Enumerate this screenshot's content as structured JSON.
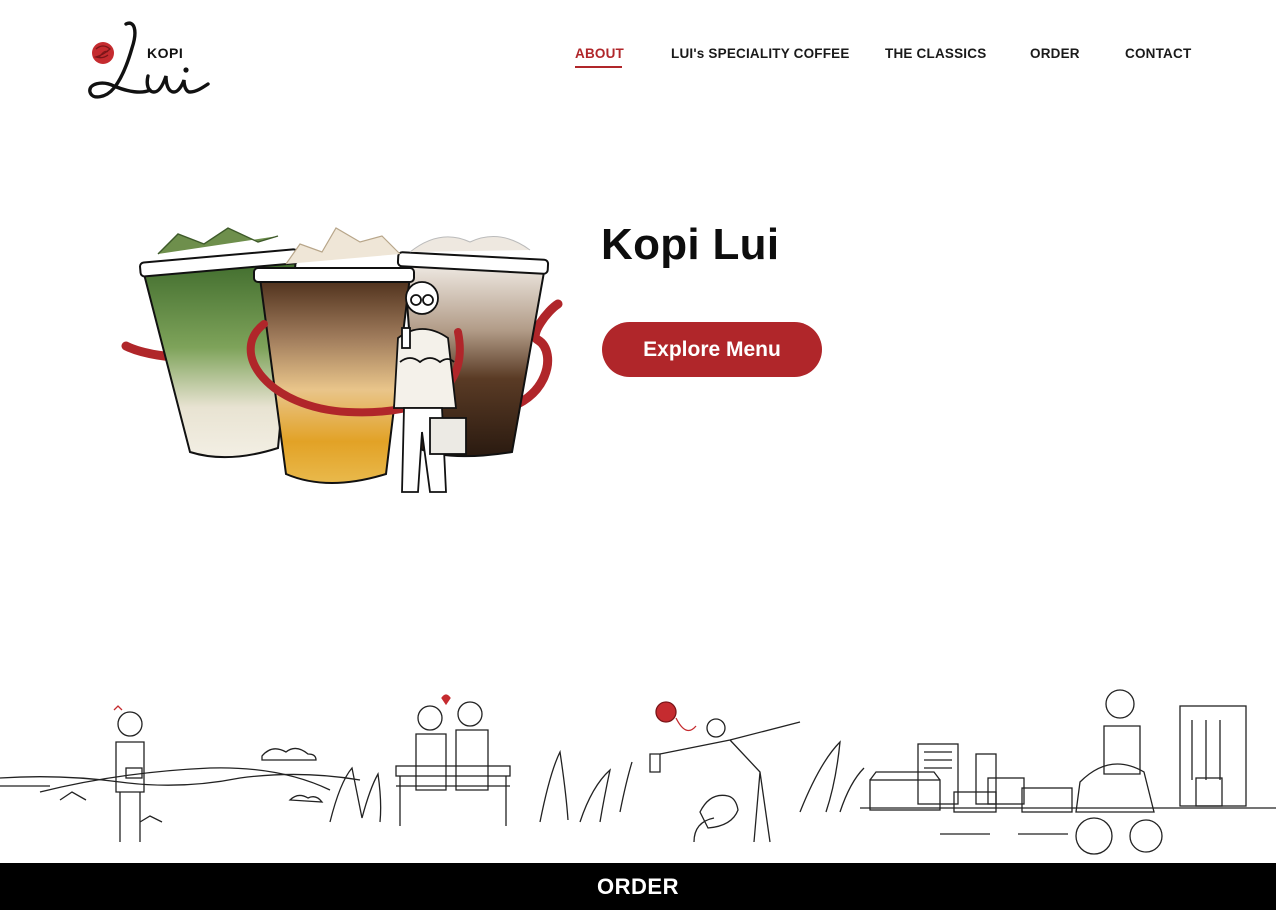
{
  "header": {
    "logo_text_top": "KOPI",
    "logo_text_script": "Lui"
  },
  "nav": {
    "items": [
      {
        "label": "ABOUT",
        "active": true
      },
      {
        "label": "LUI's SPECIALITY COFFEE",
        "active": false
      },
      {
        "label": "THE CLASSICS",
        "active": false
      },
      {
        "label": "ORDER",
        "active": false
      },
      {
        "label": "CONTACT",
        "active": false
      }
    ]
  },
  "hero": {
    "title": "Kopi Lui",
    "button_label": "Explore Menu"
  },
  "footer_bar": {
    "label": "ORDER"
  },
  "colors": {
    "accent": "#b0262a",
    "bar": "#000000",
    "text": "#111111"
  },
  "icons": {
    "logo": "kopi-lui-logo",
    "hero": "coffee-cups-illustration",
    "scene": "street-scene-illustration"
  }
}
